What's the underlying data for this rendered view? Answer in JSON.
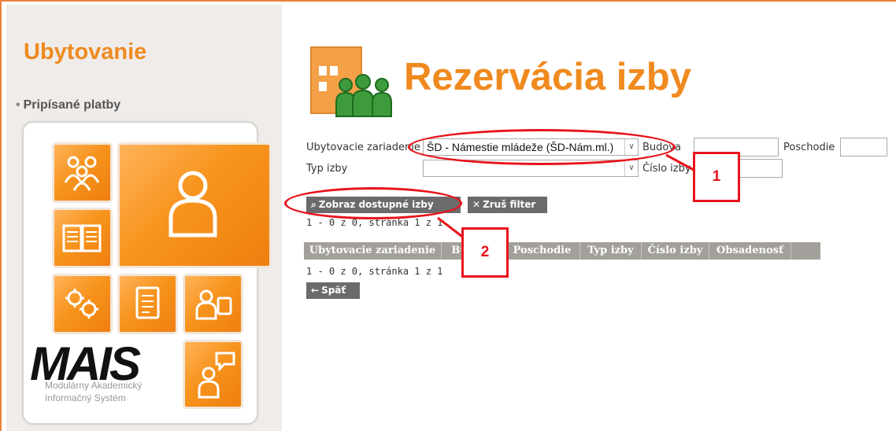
{
  "sidebar": {
    "title": "Ubytovanie",
    "link": "Pripísané platby",
    "logo": "MAIS",
    "logo_subtitle": "Modulárny Akademický Informačný Systém"
  },
  "page": {
    "title": "Rezervácia izby",
    "icon": "building-people-icon"
  },
  "filters": {
    "facility_label": "Ubytovacie zariadenie",
    "facility_value": "ŠD - Námestie mládeže (ŠD-Nám.ml.)",
    "building_label": "Budova",
    "floor_label": "Poschodie",
    "room_type_label": "Typ izby",
    "room_type_value": "",
    "room_number_label": "Číslo izby"
  },
  "buttons": {
    "show_rooms": "Zobraz dostupné izby",
    "clear_filter": "Zruš filter",
    "back": "Späť"
  },
  "pager_top": "1 - 0 z 0, stránka 1 z 1",
  "pager_bottom": "1 - 0 z 0, stránka 1 z 1",
  "table": {
    "columns": [
      "Ubytovacie zariadenie",
      "Budova",
      "Poschodie",
      "Typ izby",
      "Číslo izby",
      "Obsadenosť"
    ]
  },
  "annotations": {
    "callout_1": "1",
    "callout_2": "2",
    "color": "#e8141b"
  },
  "colors": {
    "accent": "#f08a1f",
    "header_bg": "#a3a09b",
    "button_bg": "#6b6b6b"
  }
}
